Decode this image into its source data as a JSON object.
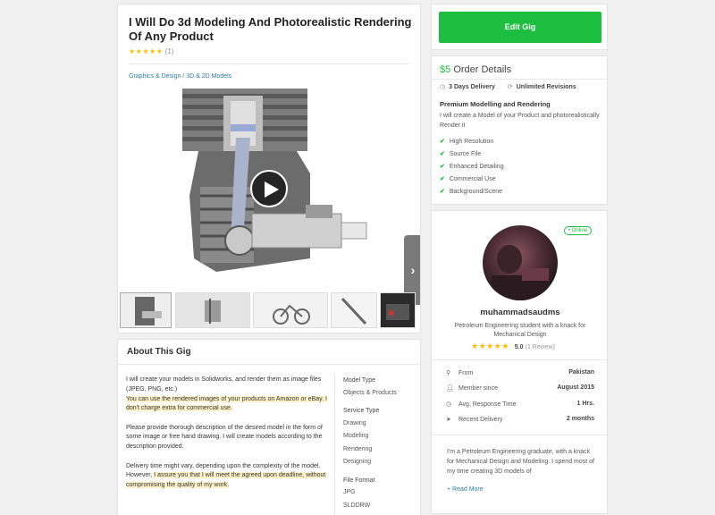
{
  "gig": {
    "title": "I Will Do 3d Modeling And Photorealistic Rendering Of Any Product",
    "stars": "★★★★★",
    "review_count": "(1)",
    "breadcrumb": "Graphics & Design / 3D & 2D Models"
  },
  "about": {
    "heading": "About This Gig",
    "p1_plain": "I will create your models in Solidworks, and render them as image files (JPEG, PNG, etc.)",
    "p1_highlight": "You can use the rendered images of your products on Amazon or eBay. I don't charge extra for commercial use.",
    "p2": "Please provide thorough description of the desired model in the form of some image or free hand drawing. I will create models according to the description provided.",
    "p3_plain": "Delivery time might vary, depending upon the complexity of the model. However,",
    "p3_highlight": "I assure you that I will meet the agreed upon deadline, without compromising the quality of my work.",
    "meta": {
      "model_type_label": "Model Type",
      "model_type_value": "Objects & Products",
      "service_type_label": "Service Type",
      "service_types": [
        "Drawing",
        "Modeling",
        "Rendering",
        "Designing"
      ],
      "file_format_label": "File Format",
      "file_formats": [
        "JPG",
        "SLDDRW"
      ]
    }
  },
  "edit_button": "Edit Gig",
  "order": {
    "price": "$5",
    "title": "Order Details",
    "delivery": "3 Days Delivery",
    "revisions": "Unlimited Revisions",
    "package_title": "Premium Modelling and Rendering",
    "package_desc": "I will create a Model of your Product and photorealistically Render it",
    "features": [
      "High Resolution",
      "Source File",
      "Enhanced Detailing",
      "Commercial Use",
      "Background/Scene"
    ]
  },
  "seller": {
    "status": "• Online",
    "username": "muhammadsaudms",
    "tagline": "Petroleum Engineering student with a knack for Mechanical Design",
    "stars": "★★★★★",
    "rating": "5.0",
    "reviews": "(1 Review)",
    "stats": [
      {
        "label": "From",
        "value": "Pakistan",
        "icon": "location-icon"
      },
      {
        "label": "Member since",
        "value": "August 2015",
        "icon": "user-icon"
      },
      {
        "label": "Avg. Response Time",
        "value": "1 Hrs.",
        "icon": "clock-icon"
      },
      {
        "label": "Recent Delivery",
        "value": "2 months",
        "icon": "send-icon"
      }
    ],
    "bio": "I'm a Petroleum Engineering graduate, with a knack for Mechanical Design and Modeling. I spend most of my time creating 3D models of",
    "read_more": "+ Read More"
  },
  "colors": {
    "accent_green": "#1dbf40",
    "link_blue": "#2a7fa5",
    "star_yellow": "#ffbe00"
  }
}
